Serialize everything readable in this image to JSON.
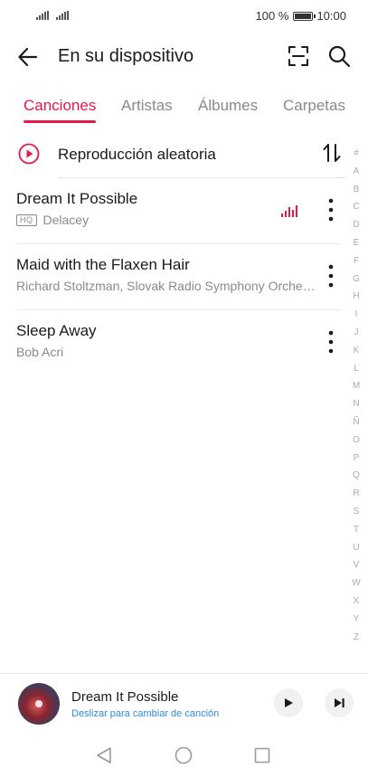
{
  "status_bar": {
    "battery_percent": "100 %",
    "time": "10:00"
  },
  "header": {
    "title": "En su dispositivo",
    "back_icon": "arrow-left-icon",
    "scan_icon": "scan-icon",
    "search_icon": "search-icon"
  },
  "tabs": [
    {
      "label": "Canciones",
      "active": true
    },
    {
      "label": "Artistas",
      "active": false
    },
    {
      "label": "Álbumes",
      "active": false
    },
    {
      "label": "Carpetas",
      "active": false
    }
  ],
  "shuffle": {
    "label": "Reproducción aleatoria"
  },
  "songs": [
    {
      "title": "Dream It Possible",
      "badge": "HQ",
      "artist": "Delacey",
      "playing": true
    },
    {
      "title": "Maid with the Flaxen Hair",
      "artist": "Richard Stoltzman, Slovak Radio Symphony Orche…",
      "playing": false
    },
    {
      "title": "Sleep Away",
      "artist": "Bob Acri",
      "playing": false
    }
  ],
  "alpha_index": [
    "#",
    "A",
    "B",
    "C",
    "D",
    "E",
    "F",
    "G",
    "H",
    "I",
    "J",
    "K",
    "L",
    "M",
    "N",
    "Ñ",
    "O",
    "P",
    "Q",
    "R",
    "S",
    "T",
    "U",
    "V",
    "W",
    "X",
    "Y",
    "Z"
  ],
  "mini_player": {
    "title": "Dream It Possible",
    "subtitle": "Deslizar para cambiar de canción"
  },
  "colors": {
    "accent": "#e8174a",
    "link": "#2f8ae0",
    "secondary_text": "#8a8a8a"
  }
}
